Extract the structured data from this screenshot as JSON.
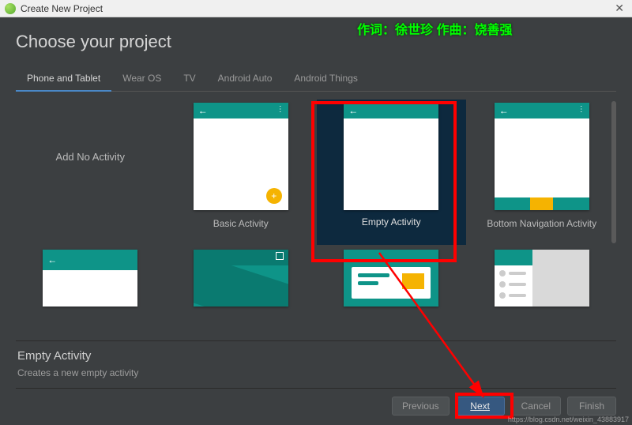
{
  "titlebar": {
    "title": "Create New Project"
  },
  "heading": "Choose your project",
  "tabs": [
    {
      "label": "Phone and Tablet",
      "active": true
    },
    {
      "label": "Wear OS",
      "active": false
    },
    {
      "label": "TV",
      "active": false
    },
    {
      "label": "Android Auto",
      "active": false
    },
    {
      "label": "Android Things",
      "active": false
    }
  ],
  "templates_row1": [
    {
      "kind": "none",
      "label": "Add No Activity",
      "selected": false
    },
    {
      "kind": "basic",
      "label": "Basic Activity",
      "selected": false
    },
    {
      "kind": "empty",
      "label": "Empty Activity",
      "selected": true
    },
    {
      "kind": "bottom",
      "label": "Bottom Navigation Activity",
      "selected": false
    }
  ],
  "templates_row2": [
    {
      "kind": "fragvm"
    },
    {
      "kind": "full"
    },
    {
      "kind": "google"
    },
    {
      "kind": "drawer"
    }
  ],
  "detail": {
    "title": "Empty Activity",
    "desc": "Creates a new empty activity"
  },
  "footer": {
    "previous": "Previous",
    "next": "Next",
    "cancel": "Cancel",
    "finish": "Finish"
  },
  "annotations": {
    "watermark_cn": "作词：徐世珍 作曲：饶善强",
    "watermark_url": "https://blog.csdn.net/weixin_43883917"
  }
}
